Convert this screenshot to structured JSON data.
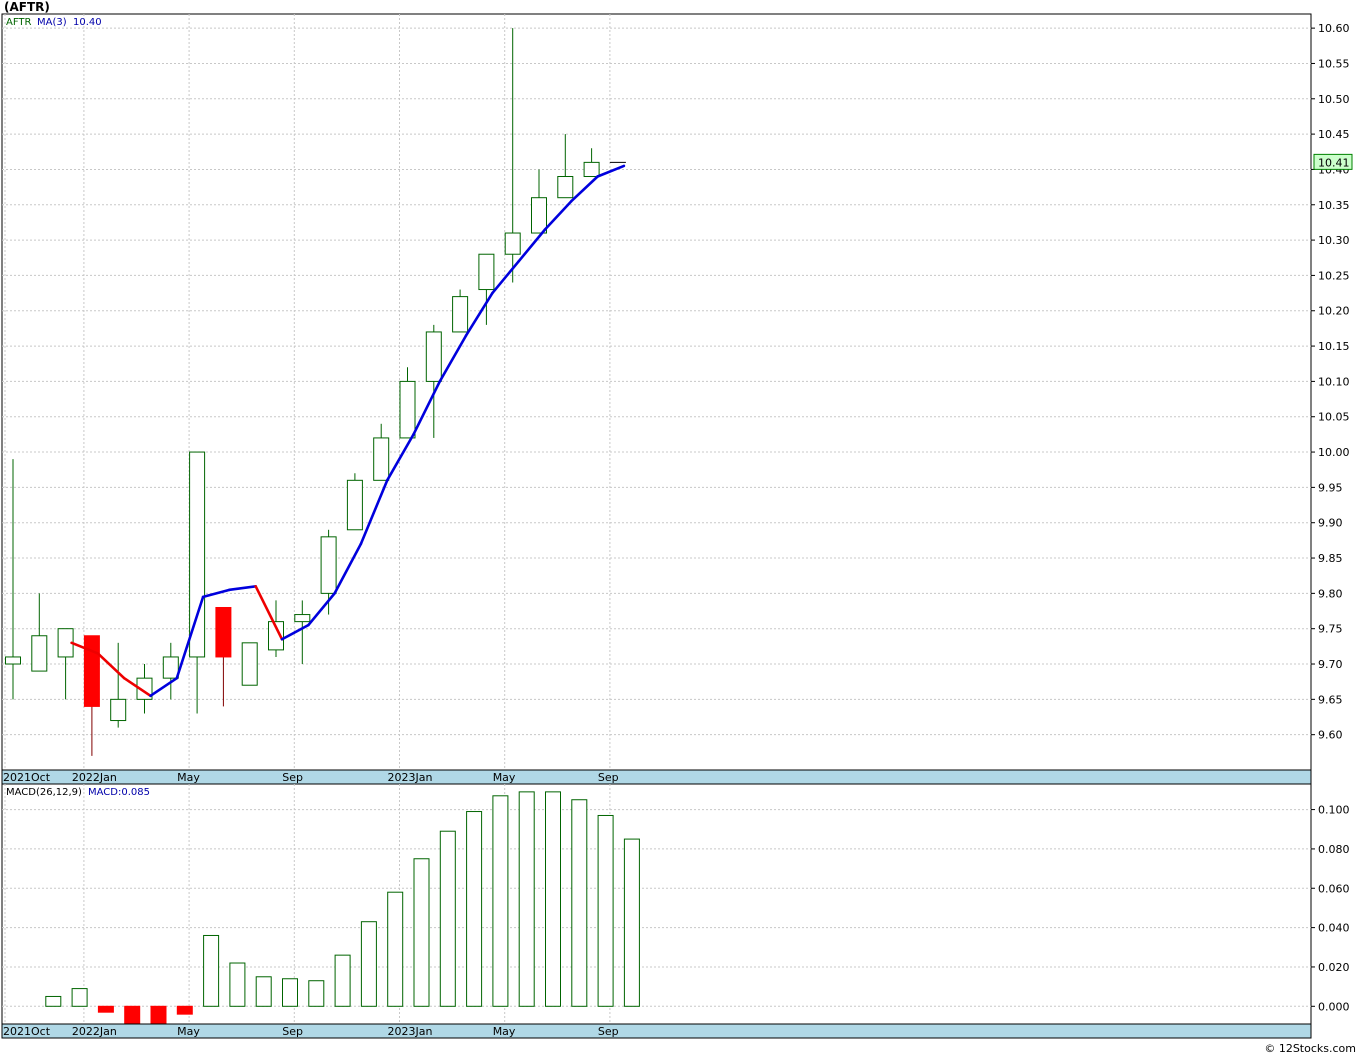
{
  "title": "(AFTR)",
  "credit": "© 12Stocks.com",
  "colors": {
    "up": "#006400",
    "down": "#ff0000",
    "ma": "#0000dd",
    "ma_down": "#ee0000",
    "axis_band": "#b0d8e6",
    "grid": "#c8c8c8",
    "price_label_bg": "#ccffcc"
  },
  "chart_data": [
    {
      "type": "candlestick",
      "symbol": "AFTR",
      "legend": {
        "symbol": "AFTR",
        "ma_label": "MA(3)",
        "ma_value": "10.40"
      },
      "last_price_label": "10.41",
      "ylim": [
        9.55,
        10.62
      ],
      "yticks": [
        "9.60",
        "9.65",
        "9.70",
        "9.75",
        "9.80",
        "9.85",
        "9.90",
        "9.95",
        "10.00",
        "10.05",
        "10.10",
        "10.15",
        "10.20",
        "10.25",
        "10.30",
        "10.35",
        "10.40",
        "10.45",
        "10.50",
        "10.55",
        "10.60"
      ],
      "xticks": [
        "2021Oct",
        "2022Jan",
        "May",
        "Sep",
        "2023Jan",
        "May",
        "Sep"
      ],
      "grid": true,
      "candles": [
        {
          "date": "2021-10",
          "open": 9.7,
          "high": 9.99,
          "low": 9.65,
          "close": 9.71
        },
        {
          "date": "2021-11",
          "open": 9.69,
          "high": 9.8,
          "low": 9.69,
          "close": 9.74
        },
        {
          "date": "2021-12",
          "open": 9.71,
          "high": 9.75,
          "low": 9.65,
          "close": 9.75
        },
        {
          "date": "2022-01",
          "open": 9.74,
          "high": 9.74,
          "low": 9.57,
          "close": 9.64
        },
        {
          "date": "2022-02",
          "open": 9.62,
          "high": 9.73,
          "low": 9.61,
          "close": 9.65
        },
        {
          "date": "2022-03",
          "open": 9.65,
          "high": 9.7,
          "low": 9.63,
          "close": 9.68
        },
        {
          "date": "2022-04",
          "open": 9.68,
          "high": 9.73,
          "low": 9.65,
          "close": 9.71
        },
        {
          "date": "2022-05",
          "open": 9.71,
          "high": 10.0,
          "low": 9.63,
          "close": 10.0
        },
        {
          "date": "2022-06",
          "open": 9.78,
          "high": 9.78,
          "low": 9.64,
          "close": 9.71
        },
        {
          "date": "2022-07",
          "open": 9.67,
          "high": 9.73,
          "low": 9.67,
          "close": 9.73
        },
        {
          "date": "2022-08",
          "open": 9.72,
          "high": 9.79,
          "low": 9.71,
          "close": 9.76
        },
        {
          "date": "2022-09",
          "open": 9.76,
          "high": 9.79,
          "low": 9.7,
          "close": 9.77
        },
        {
          "date": "2022-10",
          "open": 9.8,
          "high": 9.89,
          "low": 9.77,
          "close": 9.88
        },
        {
          "date": "2022-11",
          "open": 9.89,
          "high": 9.97,
          "low": 9.89,
          "close": 9.96
        },
        {
          "date": "2022-12",
          "open": 9.96,
          "high": 10.04,
          "low": 9.96,
          "close": 10.02
        },
        {
          "date": "2023-01",
          "open": 10.02,
          "high": 10.12,
          "low": 10.02,
          "close": 10.1
        },
        {
          "date": "2023-02",
          "open": 10.1,
          "high": 10.18,
          "low": 10.02,
          "close": 10.17
        },
        {
          "date": "2023-03",
          "open": 10.17,
          "high": 10.23,
          "low": 10.17,
          "close": 10.22
        },
        {
          "date": "2023-04",
          "open": 10.23,
          "high": 10.28,
          "low": 10.18,
          "close": 10.28
        },
        {
          "date": "2023-05",
          "open": 10.28,
          "high": 10.6,
          "low": 10.24,
          "close": 10.31
        },
        {
          "date": "2023-06",
          "open": 10.31,
          "high": 10.4,
          "low": 10.31,
          "close": 10.36
        },
        {
          "date": "2023-07",
          "open": 10.36,
          "high": 10.45,
          "low": 10.36,
          "close": 10.39
        },
        {
          "date": "2023-08",
          "open": 10.39,
          "high": 10.43,
          "low": 10.39,
          "close": 10.41
        },
        {
          "date": "2023-09",
          "open": 10.41,
          "high": 10.41,
          "low": 10.41,
          "close": 10.41
        }
      ],
      "ma3": [
        null,
        null,
        9.73,
        9.715,
        9.68,
        9.655,
        9.68,
        9.795,
        9.805,
        9.81,
        9.735,
        9.755,
        9.8,
        9.87,
        9.96,
        10.025,
        10.1,
        10.165,
        10.225,
        10.27,
        10.315,
        10.355,
        10.39,
        10.405
      ]
    },
    {
      "type": "bar",
      "legend": {
        "label": "MACD(26,12,9)",
        "value_label": "MACD:0.085"
      },
      "ylim": [
        -0.009,
        0.113
      ],
      "yticks": [
        "0.000",
        "0.020",
        "0.040",
        "0.060",
        "0.080",
        "0.100"
      ],
      "xticks": [
        "2021Oct",
        "2022Jan",
        "May",
        "Sep",
        "2023Jan",
        "May",
        "Sep"
      ],
      "grid": true,
      "values": [
        null,
        0.005,
        0.009,
        -0.003,
        -0.01,
        -0.01,
        -0.004,
        0.036,
        0.022,
        0.015,
        0.014,
        0.013,
        0.026,
        0.043,
        0.058,
        0.075,
        0.089,
        0.099,
        0.107,
        0.109,
        0.109,
        0.105,
        0.097,
        0.085
      ]
    }
  ]
}
